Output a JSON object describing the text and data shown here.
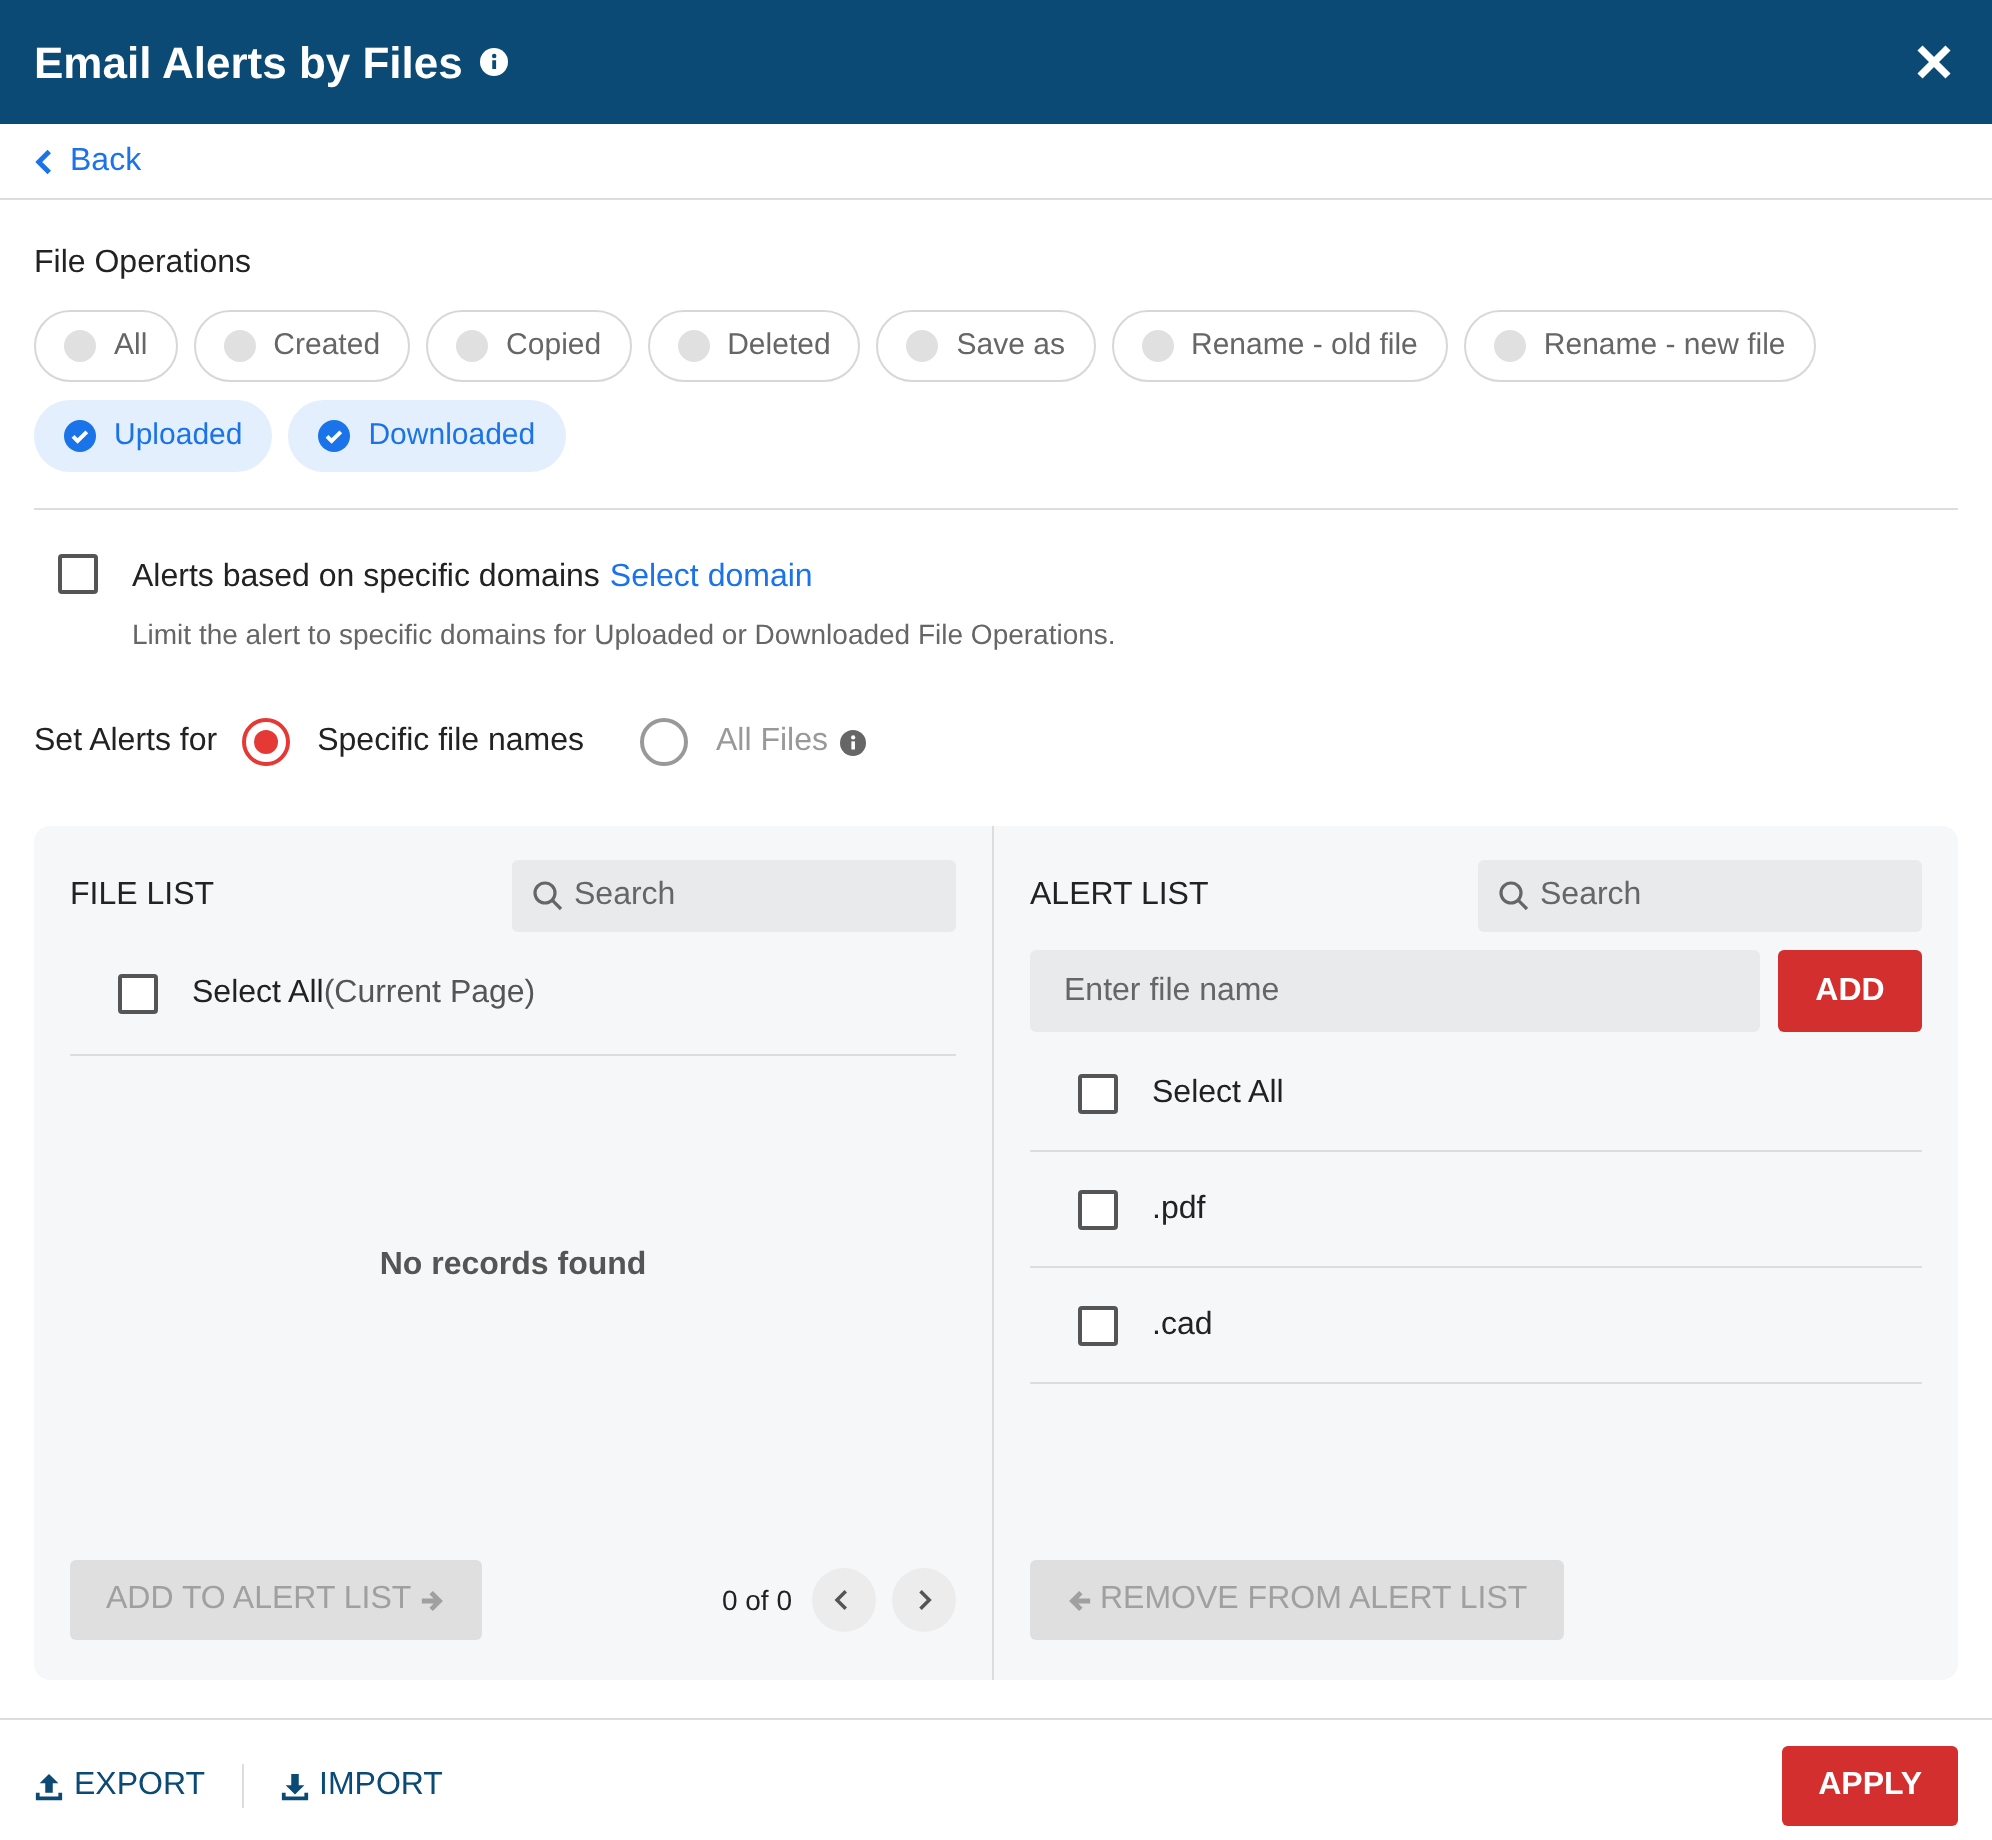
{
  "window": {
    "title": "Email Alerts by Files"
  },
  "back": "Back",
  "file_operations": {
    "label": "File Operations",
    "options": [
      {
        "label": "All",
        "checked": false
      },
      {
        "label": "Created",
        "checked": false
      },
      {
        "label": "Copied",
        "checked": false
      },
      {
        "label": "Deleted",
        "checked": false
      },
      {
        "label": "Save as",
        "checked": false
      },
      {
        "label": "Rename - old file",
        "checked": false
      },
      {
        "label": "Rename - new file",
        "checked": false
      },
      {
        "label": "Uploaded",
        "checked": true
      },
      {
        "label": "Downloaded",
        "checked": true
      }
    ]
  },
  "domain_filter": {
    "checked": false,
    "label": "Alerts based on specific domains",
    "link": "Select domain",
    "hint": "Limit the alert to specific domains for Uploaded or Downloaded File Operations."
  },
  "set_alerts": {
    "label": "Set Alerts for",
    "options": [
      {
        "label": "Specific file names",
        "selected": true,
        "info": false
      },
      {
        "label": "All Files",
        "selected": false,
        "info": true
      }
    ]
  },
  "file_list": {
    "title": "FILE LIST",
    "search_placeholder": "Search",
    "select_all": {
      "label": "Select All",
      "note": "(Current Page)",
      "checked": false
    },
    "empty": "No records found",
    "add_button": {
      "label": "ADD TO ALERT LIST",
      "disabled": true
    },
    "pagination": "0 of 0"
  },
  "alert_list": {
    "title": "ALERT LIST",
    "search_placeholder": "Search",
    "input_placeholder": "Enter file name",
    "add_button": "ADD",
    "select_all": {
      "label": "Select All",
      "checked": false
    },
    "rows": [
      {
        "name": ".pdf",
        "checked": false
      },
      {
        "name": ".cad",
        "checked": false
      }
    ],
    "remove_button": {
      "label": "REMOVE FROM ALERT LIST",
      "disabled": true
    }
  },
  "footer": {
    "export": "EXPORT",
    "import": "IMPORT",
    "apply": "APPLY"
  }
}
